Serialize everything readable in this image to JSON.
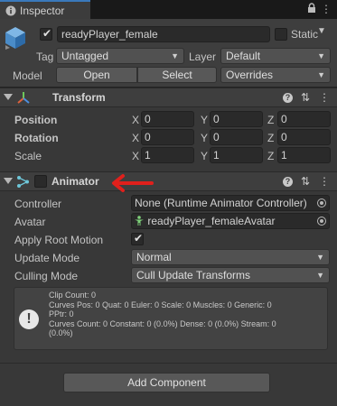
{
  "window": {
    "tab_title": "Inspector",
    "controls": [
      "lock-icon",
      "menu-icon"
    ]
  },
  "gameobject": {
    "active": true,
    "name": "readyPlayer_female",
    "static_label": "Static",
    "static": false,
    "tag_label": "Tag",
    "tag_value": "Untagged",
    "layer_label": "Layer",
    "layer_value": "Default",
    "model_label": "Model",
    "open_label": "Open",
    "select_label": "Select",
    "overrides_label": "Overrides"
  },
  "transform": {
    "title": "Transform",
    "rows": [
      {
        "label": "Position",
        "x": "0",
        "y": "0",
        "z": "0"
      },
      {
        "label": "Rotation",
        "x": "0",
        "y": "0",
        "z": "0"
      },
      {
        "label": "Scale",
        "x": "1",
        "y": "1",
        "z": "1"
      }
    ],
    "axis": {
      "x": "X",
      "y": "Y",
      "z": "Z"
    }
  },
  "animator": {
    "title": "Animator",
    "enabled": false,
    "controller_label": "Controller",
    "controller_value": "None (Runtime Animator Controller)",
    "avatar_label": "Avatar",
    "avatar_value": "readyPlayer_femaleAvatar",
    "root_motion_label": "Apply Root Motion",
    "root_motion": true,
    "update_mode_label": "Update Mode",
    "update_mode_value": "Normal",
    "culling_mode_label": "Culling Mode",
    "culling_mode_value": "Cull Update Transforms",
    "info_lines": [
      "Clip Count: 0",
      "Curves Pos: 0 Quat: 0 Euler: 0 Scale: 0 Muscles: 0 Generic: 0",
      "PPtr: 0",
      "Curves Count: 0 Constant: 0 (0.0%) Dense: 0 (0.0%) Stream: 0",
      "(0.0%)"
    ]
  },
  "footer": {
    "add_component_label": "Add Component"
  },
  "colors": {
    "accent_tab": "#3a79bb",
    "annotation_arrow": "#e0201c"
  }
}
